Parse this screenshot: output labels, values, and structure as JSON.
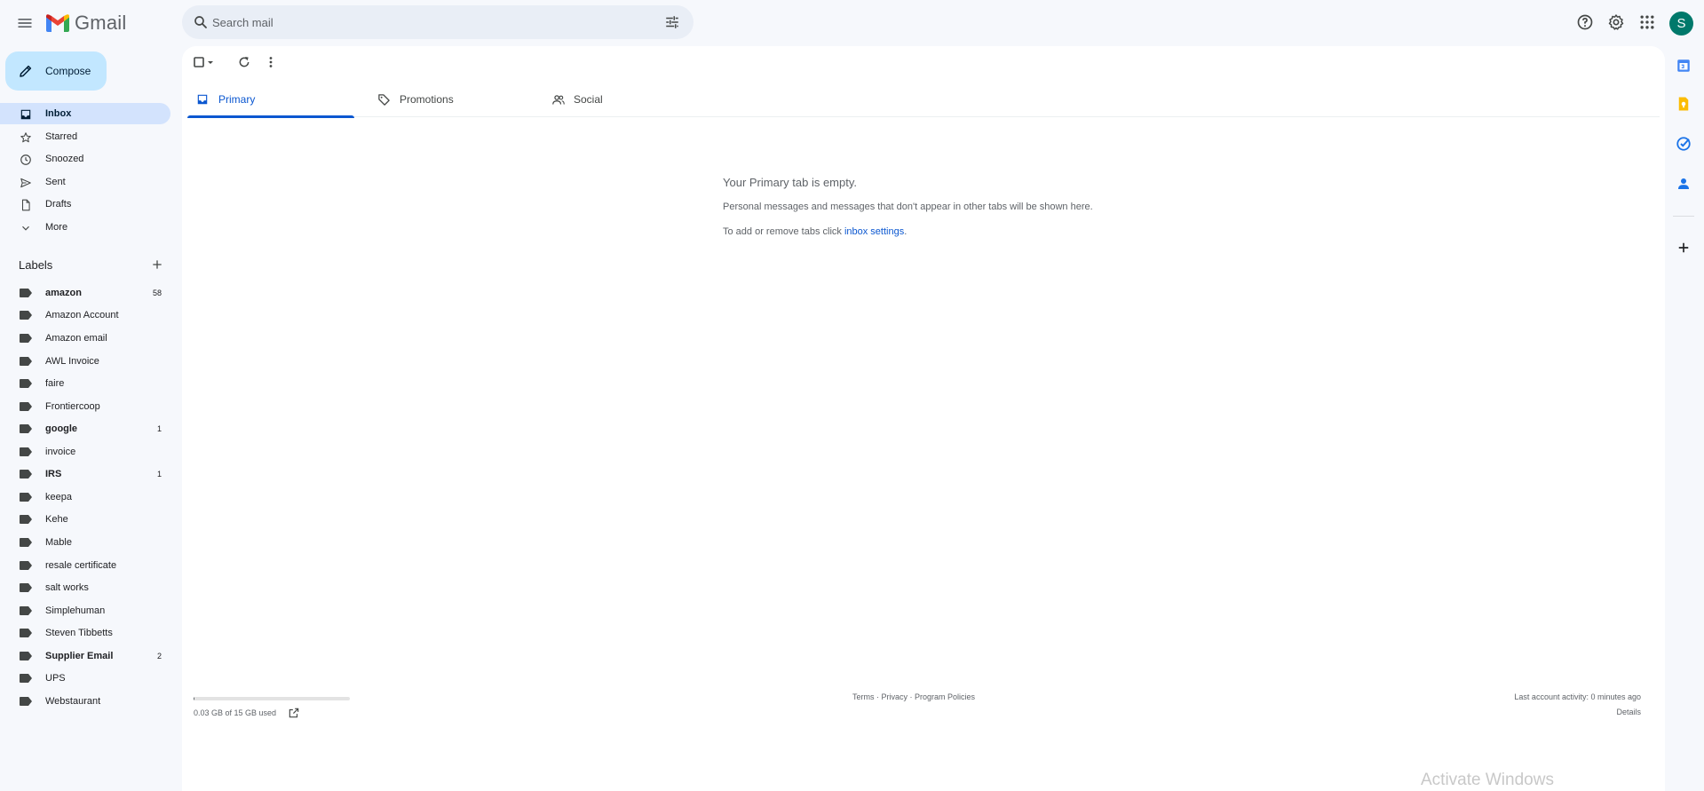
{
  "app": {
    "name": "Gmail"
  },
  "search": {
    "placeholder": "Search mail"
  },
  "account": {
    "avatar_initial": "S",
    "avatar_color": "#00796b"
  },
  "compose": {
    "label": "Compose"
  },
  "nav": [
    {
      "label": "Inbox",
      "icon": "inbox-icon",
      "active": true
    },
    {
      "label": "Starred",
      "icon": "star-icon"
    },
    {
      "label": "Snoozed",
      "icon": "clock-icon"
    },
    {
      "label": "Sent",
      "icon": "send-icon"
    },
    {
      "label": "Drafts",
      "icon": "draft-icon"
    },
    {
      "label": "More",
      "icon": "chevron-down-icon"
    }
  ],
  "labels": {
    "heading": "Labels",
    "items": [
      {
        "name": "amazon",
        "count": "58",
        "bold": true
      },
      {
        "name": "Amazon Account",
        "count": ""
      },
      {
        "name": "Amazon email",
        "count": ""
      },
      {
        "name": "AWL Invoice",
        "count": ""
      },
      {
        "name": "faire",
        "count": ""
      },
      {
        "name": "Frontiercoop",
        "count": ""
      },
      {
        "name": "google",
        "count": "1",
        "bold": true
      },
      {
        "name": "invoice",
        "count": ""
      },
      {
        "name": "IRS",
        "count": "1",
        "bold": true
      },
      {
        "name": "keepa",
        "count": ""
      },
      {
        "name": "Kehe",
        "count": ""
      },
      {
        "name": "Mable",
        "count": ""
      },
      {
        "name": "resale certificate",
        "count": ""
      },
      {
        "name": "salt works",
        "count": ""
      },
      {
        "name": "Simplehuman",
        "count": ""
      },
      {
        "name": "Steven Tibbetts",
        "count": ""
      },
      {
        "name": "Supplier Email",
        "count": "2",
        "bold": true
      },
      {
        "name": "UPS",
        "count": ""
      },
      {
        "name": "Webstaurant",
        "count": ""
      }
    ]
  },
  "tabs": [
    {
      "label": "Primary",
      "icon": "inbox-icon",
      "active": true
    },
    {
      "label": "Promotions",
      "icon": "tag-icon"
    },
    {
      "label": "Social",
      "icon": "people-icon"
    }
  ],
  "empty_state": {
    "title": "Your Primary tab is empty.",
    "line1": "Personal messages and messages that don't appear in other tabs will be shown here.",
    "line2_prefix": "To add or remove tabs click ",
    "line2_link": "inbox settings",
    "line2_suffix": "."
  },
  "footer": {
    "storage_text": "0.03 GB of 15 GB used",
    "storage_fraction": 0.002,
    "links": [
      "Terms",
      "Privacy",
      "Program Policies"
    ],
    "separator": " · ",
    "activity": "Last account activity: 0 minutes ago",
    "details": "Details"
  },
  "watermark": "Activate Windows",
  "colors": {
    "accent": "#0b57d0",
    "compose_bg": "#c2e7ff",
    "active_nav_bg": "#d3e3fd"
  }
}
